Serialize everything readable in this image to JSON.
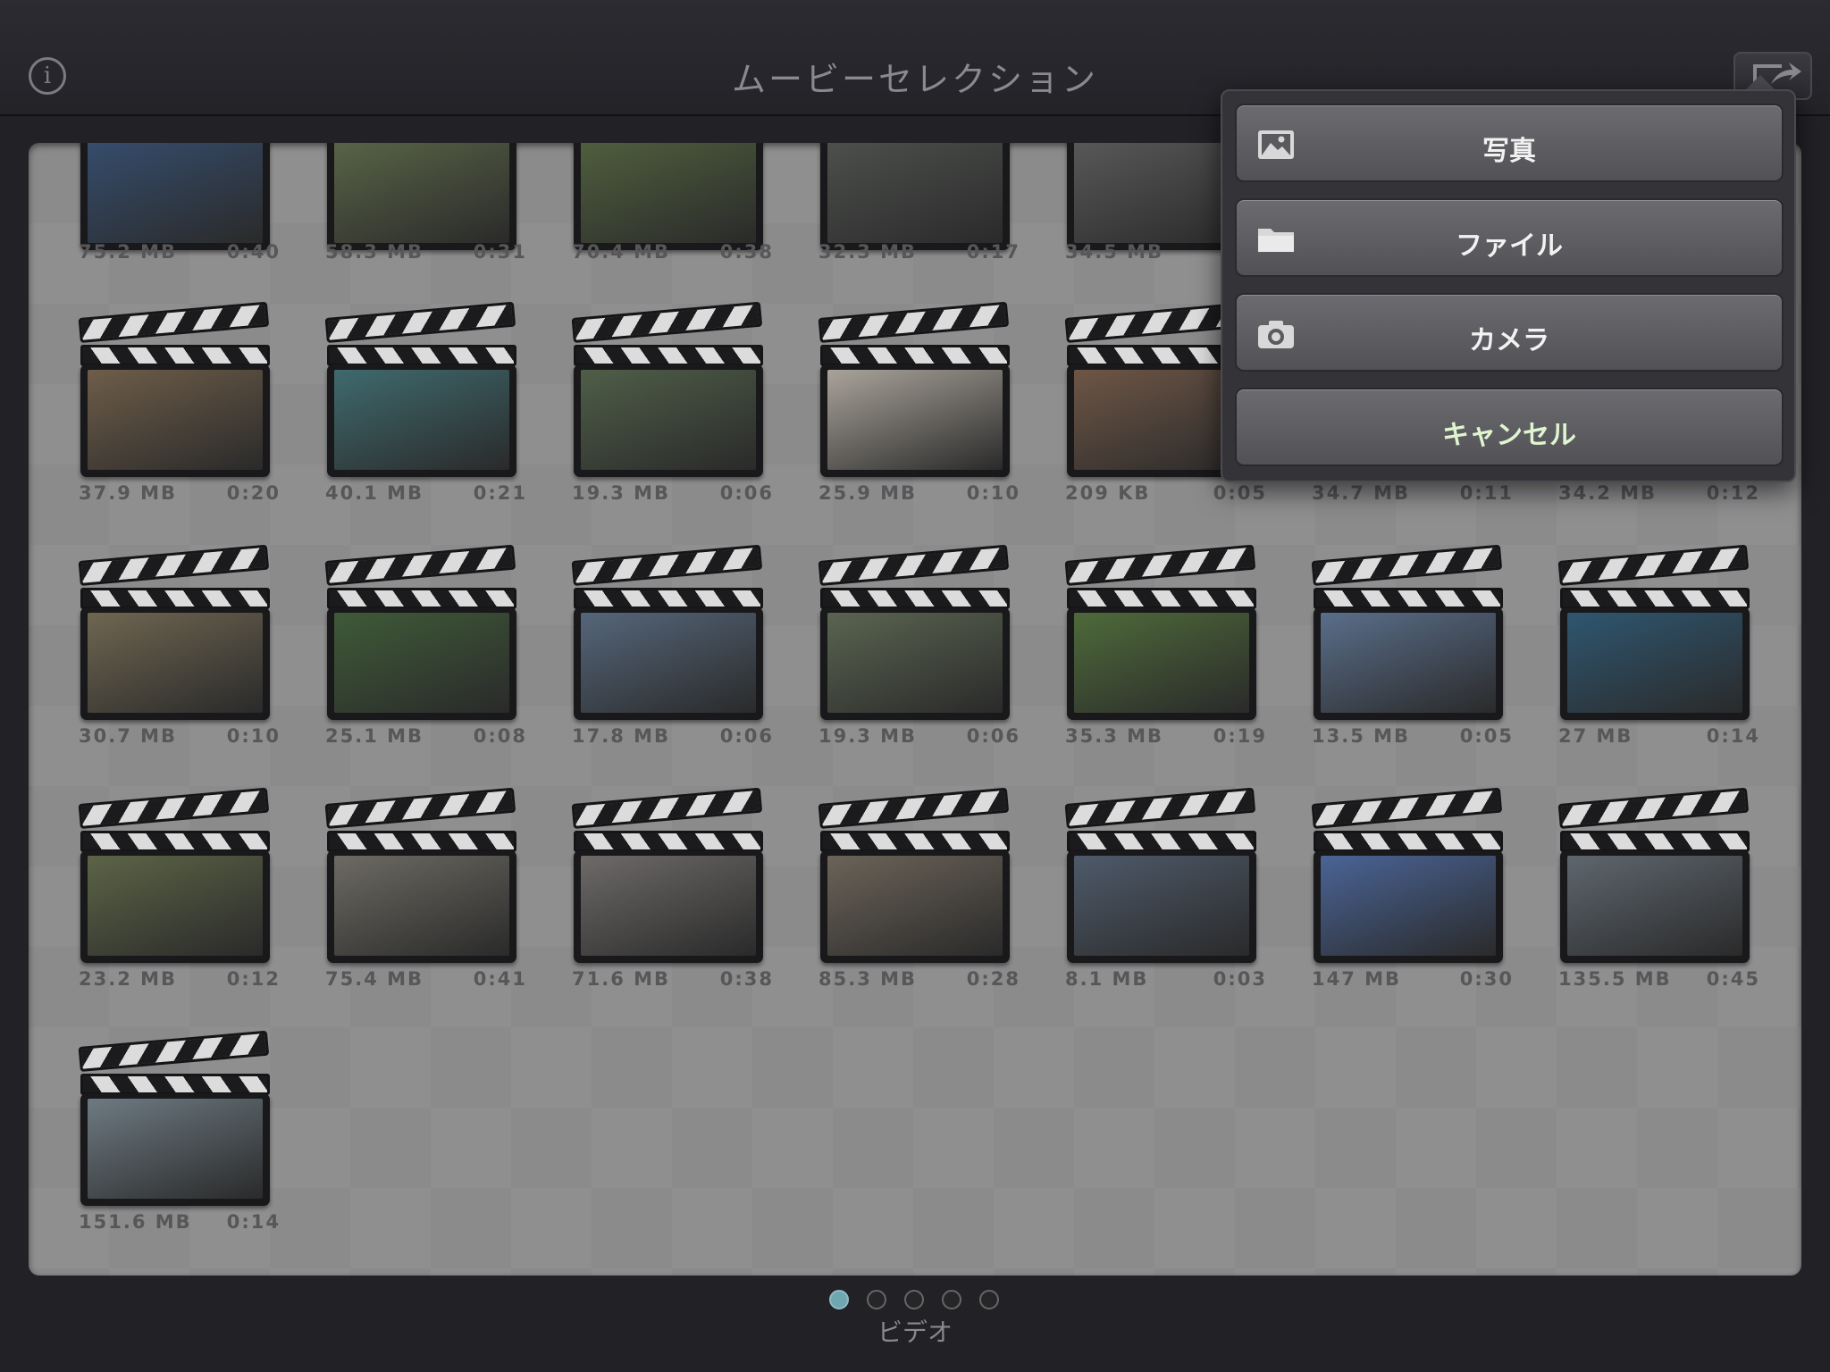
{
  "header": {
    "title": "ムービーセレクション",
    "info_glyph": "i"
  },
  "popover": {
    "items": [
      {
        "label": "写真",
        "icon": "photo-icon"
      },
      {
        "label": "ファイル",
        "icon": "folder-icon"
      },
      {
        "label": "カメラ",
        "icon": "camera-icon"
      },
      {
        "label": "キャンセル",
        "icon": ""
      }
    ]
  },
  "pager": {
    "label": "ビデオ",
    "pages": 5,
    "current": 1
  },
  "videos": [
    {
      "size": "75.2 MB",
      "duration": "0:40",
      "color": "#3a5a86"
    },
    {
      "size": "58.3 MB",
      "duration": "0:31",
      "color": "#6b7a52"
    },
    {
      "size": "70.4 MB",
      "duration": "0:38",
      "color": "#5e7345"
    },
    {
      "size": "32.3 MB",
      "duration": "0:17",
      "color": "#5a5e5a"
    },
    {
      "size": "34.5 MB",
      "duration": "0:",
      "color": "#6a6a6a"
    },
    {
      "size": "",
      "duration": "",
      "color": "#6a6a6a"
    },
    {
      "size": "",
      "duration": "",
      "color": "#6a6a6a"
    },
    {
      "size": "37.9 MB",
      "duration": "0:20",
      "color": "#6e5d49"
    },
    {
      "size": "40.1 MB",
      "duration": "0:21",
      "color": "#3f6a6e"
    },
    {
      "size": "19.3 MB",
      "duration": "0:06",
      "color": "#4f5e48"
    },
    {
      "size": "25.9 MB",
      "duration": "0:10",
      "color": "#a9a39a"
    },
    {
      "size": "209 KB",
      "duration": "0:05",
      "color": "#6e5646"
    },
    {
      "size": "34.7 MB",
      "duration": "0:11",
      "color": "#6a6a6a"
    },
    {
      "size": "34.2 MB",
      "duration": "0:12",
      "color": "#6a6a6a"
    },
    {
      "size": "30.7 MB",
      "duration": "0:10",
      "color": "#6f6651"
    },
    {
      "size": "25.1 MB",
      "duration": "0:08",
      "color": "#3f5a38"
    },
    {
      "size": "17.8 MB",
      "duration": "0:06",
      "color": "#55667a"
    },
    {
      "size": "19.3 MB",
      "duration": "0:06",
      "color": "#5a6450"
    },
    {
      "size": "35.3 MB",
      "duration": "0:19",
      "color": "#4e6a3a"
    },
    {
      "size": "13.5 MB",
      "duration": "0:05",
      "color": "#5a6e8a"
    },
    {
      "size": "27 MB",
      "duration": "0:14",
      "color": "#2f5670"
    },
    {
      "size": "23.2 MB",
      "duration": "0:12",
      "color": "#5c6446"
    },
    {
      "size": "75.4 MB",
      "duration": "0:41",
      "color": "#6c6a62"
    },
    {
      "size": "71.6 MB",
      "duration": "0:38",
      "color": "#6d6a68"
    },
    {
      "size": "85.3 MB",
      "duration": "0:28",
      "color": "#6b6358"
    },
    {
      "size": "8.1 MB",
      "duration": "0:03",
      "color": "#4e5a6a"
    },
    {
      "size": "147 MB",
      "duration": "0:30",
      "color": "#4a6496"
    },
    {
      "size": "135.5 MB",
      "duration": "0:45",
      "color": "#5e666e"
    },
    {
      "size": "151.6 MB",
      "duration": "0:14",
      "color": "#6d7a82"
    }
  ]
}
